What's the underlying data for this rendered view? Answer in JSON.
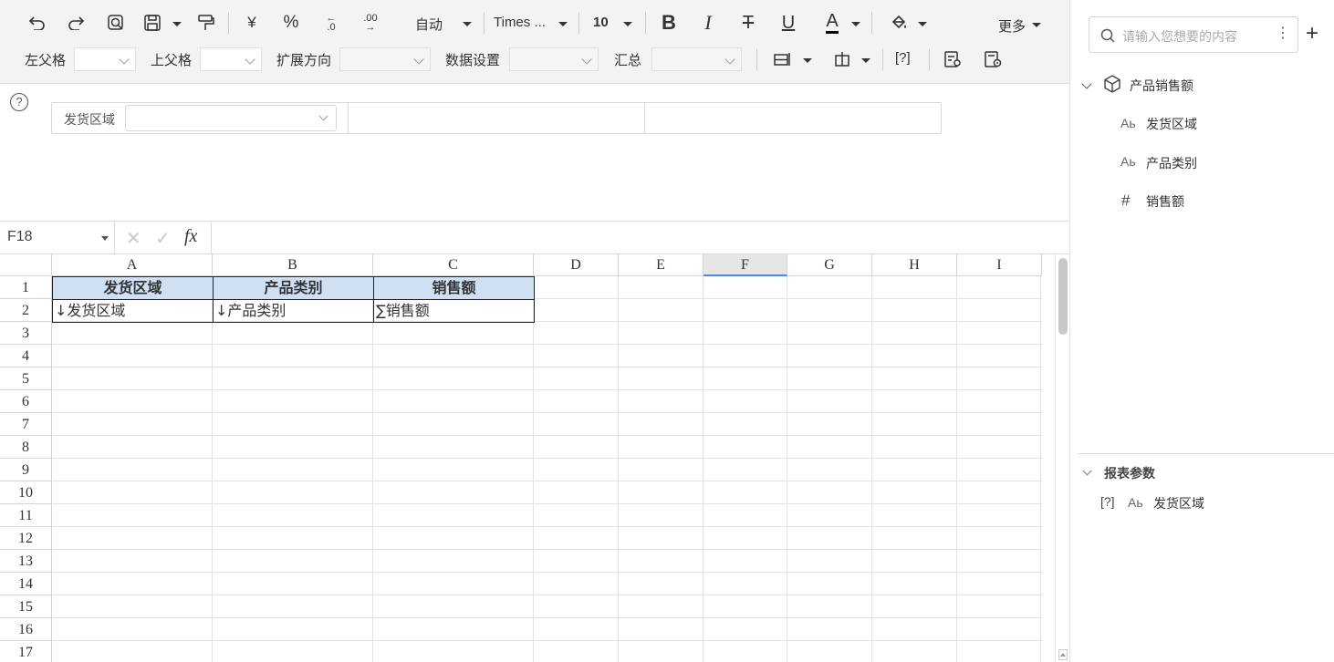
{
  "toolbar": {
    "row1": {
      "undo_icon": "undo-icon",
      "redo_icon": "redo-icon",
      "preview_icon": "preview-icon",
      "save_icon": "save-icon",
      "format_painter_icon": "format-painter-icon",
      "currency_label": "¥",
      "percent_label": "%",
      "decrease_decimal_label": ".0",
      "increase_decimal_label": ".00",
      "number_format": "自动",
      "font_name": "Times ...",
      "font_size": "10",
      "bold_label": "B",
      "italic_label": "I",
      "strike_label": "T",
      "underline_label": "U",
      "font_color_label": "A",
      "fill_icon": "fill-color-icon",
      "more_label": "更多"
    },
    "row2": {
      "left_parent_label": "左父格",
      "left_parent_value": "",
      "top_parent_label": "上父格",
      "top_parent_value": "",
      "expand_label": "扩展方向",
      "expand_value": "",
      "data_setting_label": "数据设置",
      "data_setting_value": "",
      "summary_label": "汇总",
      "summary_value": "",
      "param_bracket_label": "[?]"
    }
  },
  "param_area": {
    "help_label": "?",
    "param_label": "发货区域",
    "param_value": ""
  },
  "formula_bar": {
    "cell_ref": "F18",
    "fx_label": "fx",
    "formula": ""
  },
  "grid": {
    "columns": [
      "A",
      "B",
      "C",
      "D",
      "E",
      "F",
      "G",
      "H",
      "I"
    ],
    "selected_column": "F",
    "rows": [
      "1",
      "2",
      "3",
      "4",
      "5",
      "6",
      "7",
      "8",
      "9",
      "10",
      "11",
      "12",
      "13",
      "14",
      "15",
      "16",
      "17"
    ],
    "header_cells": [
      "发货区域",
      "产品类别",
      "销售额"
    ],
    "data_cells": [
      "↓发货区域",
      "↓产品类别",
      "∑销售额"
    ]
  },
  "sidebar": {
    "search_placeholder": "请输入您想要的内容",
    "dataset_name": "产品销售额",
    "fields": [
      {
        "type": "Aь",
        "name": "发货区域"
      },
      {
        "type": "Aь",
        "name": "产品类别"
      },
      {
        "type": "#",
        "name": "销售额"
      }
    ],
    "params_section_title": "报表参数",
    "params": [
      {
        "prefix": "[?]",
        "type": "Aь",
        "name": "发货区域"
      }
    ]
  }
}
